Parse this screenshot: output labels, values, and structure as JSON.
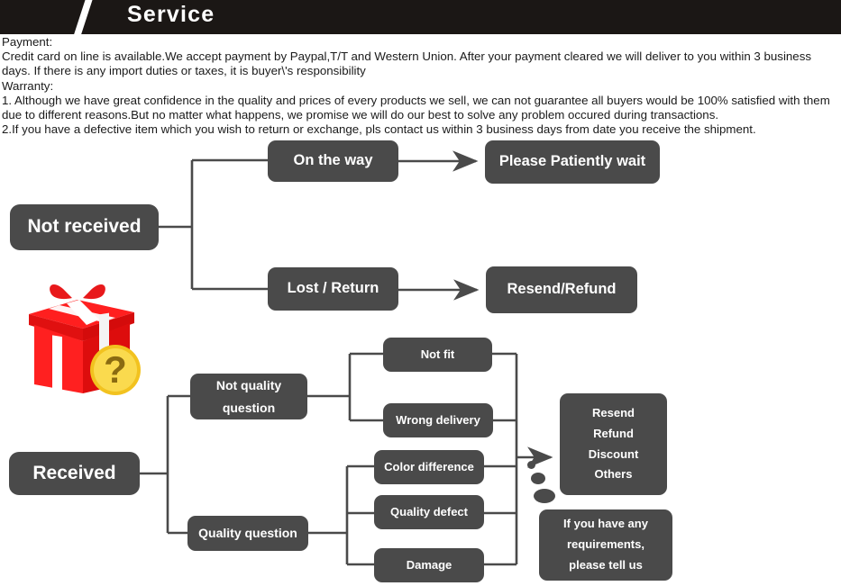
{
  "header": {
    "title": "Service",
    "slash_icon": "slash-icon",
    "bg_color": "#1b1715"
  },
  "copy": {
    "payment_heading": "Payment:",
    "payment_text": "Credit card on line is available.We accept payment by Paypal,T/T and Western Union. After your payment cleared we will deliver to you within 3 business days. If there is any import duties or taxes, it is buyer\\'s responsibility",
    "warranty_heading": "Warranty:",
    "warranty_1": "1. Although we have great confidence in the quality and prices of every products we sell, we can not guarantee all buyers would be 100% satisfied with them due to different reasons.But no matter what happens, we promise we will do our best to solve any problem occured during transactions.",
    "warranty_2": "2.If you have a defective item which you wish to return or exchange, pls contact us within 3 business days from date you receive the shipment."
  },
  "flowchart": {
    "node_color": "#4a4a4a",
    "text_color": "#ffffff",
    "top": {
      "root": "Not received",
      "branch_1": "On the way",
      "branch_1_result": "Please Patiently wait",
      "branch_2": "Lost / Return",
      "branch_2_result": "Resend/Refund"
    },
    "bottom": {
      "root": "Received",
      "branch_1": {
        "label_line_1": "Not quality",
        "label_line_2": "question",
        "leaves": [
          "Not fit",
          "Wrong delivery"
        ]
      },
      "branch_2": {
        "label": "Quality question",
        "leaves": [
          "Color difference",
          "Quality defect",
          "Damage"
        ]
      },
      "outcome": [
        "Resend",
        "Refund",
        "Discount",
        "Others"
      ],
      "note": [
        "If you have any",
        "requirements,",
        "please tell us"
      ]
    }
  },
  "gift_icon": {
    "name": "gift-box-question-icon",
    "box_color": "#ee1c1c",
    "ribbon_color": "#ffffff",
    "badge_color": "#f5cf2b",
    "badge_glyph": "?"
  }
}
